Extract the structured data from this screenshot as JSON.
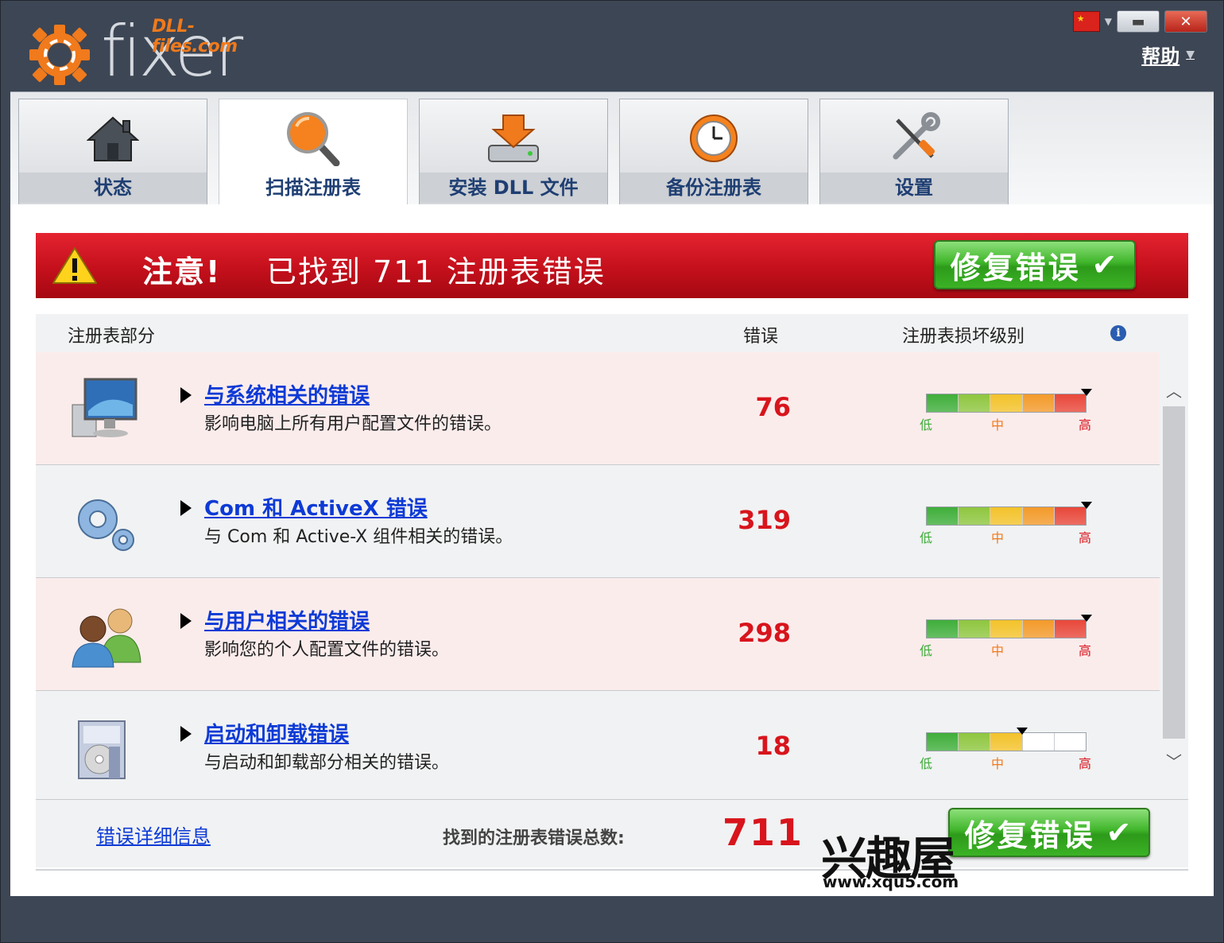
{
  "app": {
    "logo_sub": "DLL-files.com",
    "logo_main": "fixer",
    "help_label": "帮助",
    "minimize": "▬",
    "close": "✕"
  },
  "tabs": [
    {
      "label": "状态",
      "icon": "home-icon",
      "active": false
    },
    {
      "label": "扫描注册表",
      "icon": "magnifier-icon",
      "active": true
    },
    {
      "label": "安装 DLL 文件",
      "icon": "download-drive-icon",
      "active": false
    },
    {
      "label": "备份注册表",
      "icon": "clock-backup-icon",
      "active": false
    },
    {
      "label": "设置",
      "icon": "tools-icon",
      "active": false
    }
  ],
  "alert": {
    "attention": "注意!",
    "message": "已找到 711 注册表错误",
    "fix_button": "修复错误",
    "fix_check": "✔"
  },
  "table": {
    "columns": {
      "section": "注册表部分",
      "errors": "错误",
      "damage": "注册表损坏级别"
    },
    "rows": [
      {
        "icon": "computer-monitor-icon",
        "title": "与系统相关的错误",
        "desc": "影响电脑上所有用户配置文件的错误。",
        "count": "76",
        "level": 1.0
      },
      {
        "icon": "gears-icon",
        "title": "Com 和  ActiveX 错误",
        "desc": "与  Com 和  Active-X 组件相关的错误。",
        "count": "319",
        "level": 1.0
      },
      {
        "icon": "users-icon",
        "title": "与用户相关的错误",
        "desc": "影响您的个人配置文件的错误。",
        "count": "298",
        "level": 1.0
      },
      {
        "icon": "installer-box-icon",
        "title": "启动和卸载错误",
        "desc": "与启动和卸载部分相关的错误。",
        "count": "18",
        "level": 0.6
      }
    ],
    "meter_labels": {
      "low": "低",
      "mid": "中",
      "high": "高"
    }
  },
  "footer": {
    "details_link": "错误详细信息",
    "total_label": "找到的注册表错误总数:",
    "total": "711",
    "fix_button": "修复错误",
    "fix_check": "✔"
  },
  "watermark": {
    "text": "兴趣屋",
    "url": "www.xqu5.com"
  },
  "colors": {
    "accent_orange": "#f07a1c",
    "alert_red": "#c4101c",
    "link_blue": "#0d3ad6",
    "count_red": "#d8141c",
    "button_green": "#3fb52a"
  }
}
